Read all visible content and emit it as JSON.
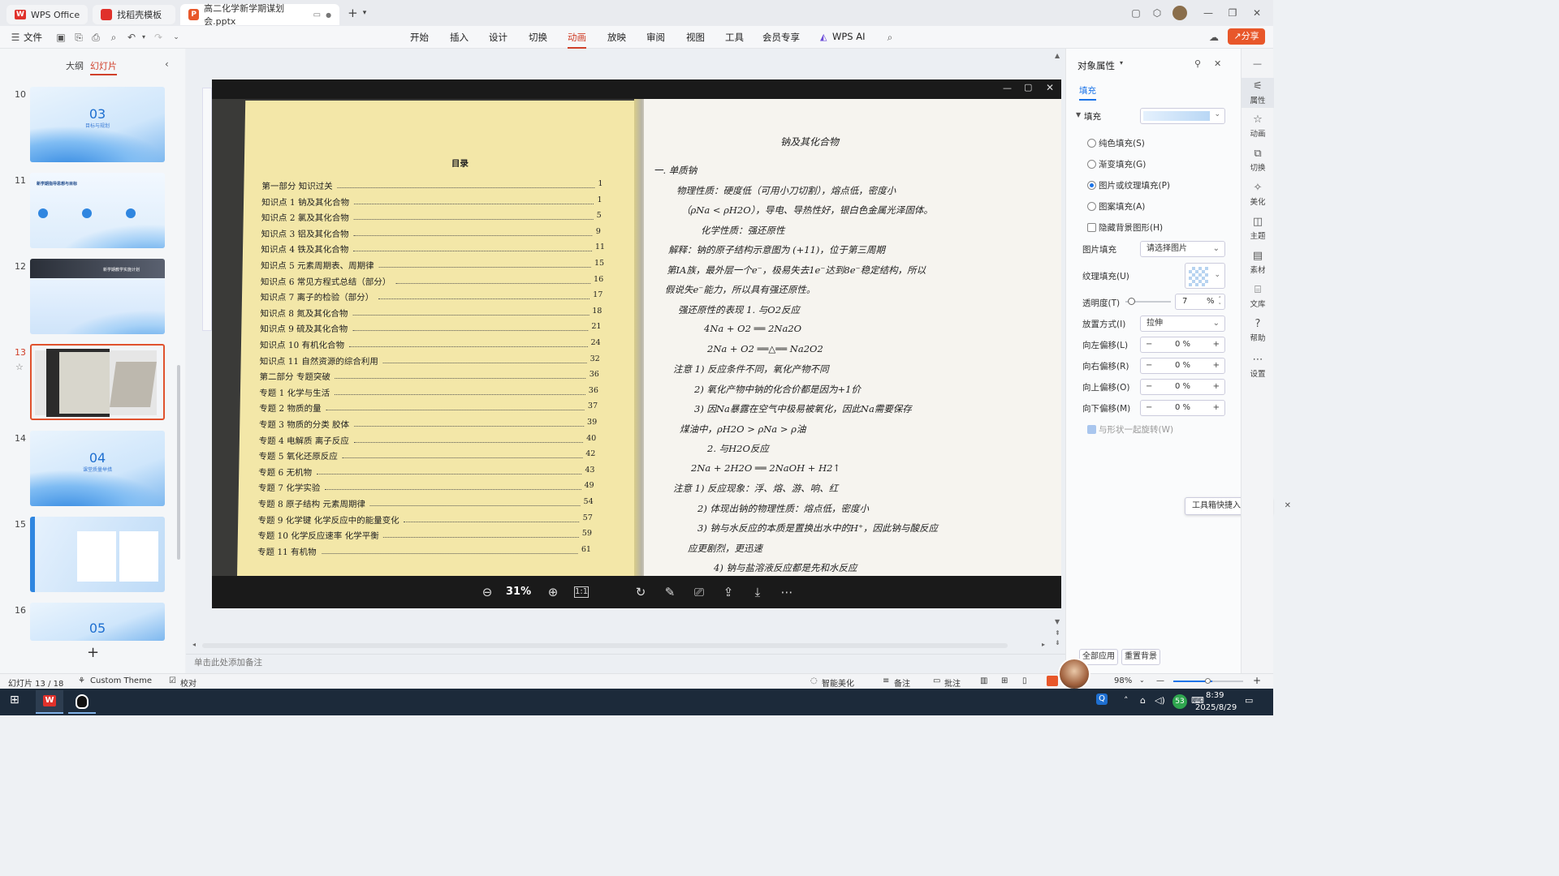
{
  "titlebar": {
    "tabs": [
      {
        "label": "WPS Office"
      },
      {
        "label": "找稻壳模板"
      },
      {
        "label": "高二化学新学期谋划会.pptx"
      }
    ],
    "new_tab": "+"
  },
  "menu": {
    "file": "文件",
    "items": [
      "开始",
      "插入",
      "设计",
      "切换",
      "动画",
      "放映",
      "审阅",
      "视图",
      "工具",
      "会员专享",
      "WPS AI"
    ],
    "active": "动画",
    "share": "分享"
  },
  "left_panel": {
    "tab_outline": "大纲",
    "tab_slides": "幻灯片",
    "slides": [
      {
        "num": "10",
        "big": "03",
        "sub": "目标与规划"
      },
      {
        "num": "11",
        "title": "新学期指导思想与目标"
      },
      {
        "num": "12",
        "title": "新学期教学实施计划"
      },
      {
        "num": "13",
        "selected": true
      },
      {
        "num": "14",
        "big": "04",
        "sub": "课堂质量举措"
      },
      {
        "num": "15"
      },
      {
        "num": "16",
        "big": "05"
      }
    ],
    "add": "+"
  },
  "viewer": {
    "zoom": "31%",
    "toc_title": "目录",
    "toc": [
      {
        "label": "第一部分   知识过关",
        "page": "1"
      },
      {
        "label": "知识点 1   钠及其化合物",
        "page": "1"
      },
      {
        "label": "知识点 2   氯及其化合物",
        "page": "5"
      },
      {
        "label": "知识点 3   铝及其化合物",
        "page": "9"
      },
      {
        "label": "知识点 4   铁及其化合物",
        "page": "11"
      },
      {
        "label": "知识点 5   元素周期表、周期律",
        "page": "15"
      },
      {
        "label": "知识点 6   常见方程式总结（部分）",
        "page": "16"
      },
      {
        "label": "知识点 7   离子的检验（部分）",
        "page": "17"
      },
      {
        "label": "知识点 8   氮及其化合物",
        "page": "18"
      },
      {
        "label": "知识点 9   硫及其化合物",
        "page": "21"
      },
      {
        "label": "知识点 10   有机化合物",
        "page": "24"
      },
      {
        "label": "知识点 11   自然资源的综合利用",
        "page": "32"
      },
      {
        "label": "第二部分   专题突破",
        "page": "36"
      },
      {
        "label": "专题 1   化学与生活",
        "page": "36"
      },
      {
        "label": "专题 2   物质的量",
        "page": "37"
      },
      {
        "label": "专题 3   物质的分类   胶体",
        "page": "39"
      },
      {
        "label": "专题 4   电解质   离子反应",
        "page": "40"
      },
      {
        "label": "专题 5   氧化还原反应",
        "page": "42"
      },
      {
        "label": "专题 6   无机物",
        "page": "43"
      },
      {
        "label": "专题 7   化学实验",
        "page": "49"
      },
      {
        "label": "专题 8   原子结构   元素周期律",
        "page": "54"
      },
      {
        "label": "专题 9   化学键   化学反应中的能量变化",
        "page": "57"
      },
      {
        "label": "专题 10   化学反应速率   化学平衡",
        "page": "59"
      },
      {
        "label": "专题 11   有机物",
        "page": "61"
      }
    ],
    "notes_title": "钠及其化合物",
    "notes": [
      "一. 单质钠",
      "物理性质：硬度低（可用小刀切割），熔点低，密度小",
      "（ρNa < ρH2O），导电、导热性好，银白色金属光泽固体。",
      "化学性质：强还原性",
      "解释：钠的原子结构示意图为 (+11)，位于第三周期",
      "第IA族，最外层一个e⁻，极易失去1e⁻达到8e⁻稳定结构，所以",
      "假说失e⁻能力，所以具有强还原性。",
      "强还原性的表现  1. 与O2反应",
      "4Na + O2 ══ 2Na2O",
      "2Na + O2 ══△══ Na2O2",
      "注意  1) 反应条件不同，氧化产物不同",
      "2) 氧化产物中钠的化合价都是因为+1价",
      "3) 因Na暴露在空气中极易被氧化，因此Na需要保存",
      "煤油中，ρH2O > ρNa > ρ油",
      "2. 与H2O反应",
      "2Na + 2H2O ══ 2NaOH + H2↑",
      "注意  1) 反应现象：浮、熔、游、响、红",
      "2) 体现出钠的物理性质：熔点低，密度小",
      "3) 钠与水反应的本质是置换出水中的H⁺，因此钠与酸反应",
      "应更剧烈，更迅速",
      "4) 钠与盐溶液反应都是先和水反应"
    ]
  },
  "canvas": {
    "notes_placeholder": "单击此处添加备注"
  },
  "right_panel": {
    "title": "对象属性",
    "tab_fill": "填充",
    "section_fill": "填充",
    "options": [
      "纯色填充(S)",
      "渐变填充(G)",
      "图片或纹理填充(P)",
      "图案填充(A)"
    ],
    "selected_option": "图片或纹理填充(P)",
    "hide_bg": "隐藏背景图形(H)",
    "pic_fill_label": "图片填充",
    "pic_fill_value": "请选择图片",
    "texture_label": "纹理填充(U)",
    "transparency_label": "透明度(T)",
    "transparency_value": "7",
    "transparency_unit": "%",
    "placement_label": "放置方式(I)",
    "placement_value": "拉伸",
    "offsets": [
      {
        "label": "向左偏移(L)",
        "value": "0 %"
      },
      {
        "label": "向右偏移(R)",
        "value": "0 %"
      },
      {
        "label": "向上偏移(O)",
        "value": "0 %"
      },
      {
        "label": "向下偏移(M)",
        "value": "0 %"
      }
    ],
    "rotate_with_shape": "与形状一起旋转(W)",
    "apply_all": "全部应用",
    "reset_bg": "重置背景",
    "tooltip": "工具箱快捷入口"
  },
  "side_icons": [
    "属性",
    "动画",
    "切换",
    "美化",
    "主题",
    "素材",
    "文库",
    "帮助",
    "设置"
  ],
  "statusbar": {
    "slide_info": "幻灯片 13 / 18",
    "theme": "Custom Theme",
    "proof": "校对",
    "smart": "智能美化",
    "notes": "备注",
    "comments": "批注",
    "zoom": "98%"
  },
  "taskbar": {
    "time": "8:39",
    "date": "2025/8/29",
    "badge": "53"
  }
}
